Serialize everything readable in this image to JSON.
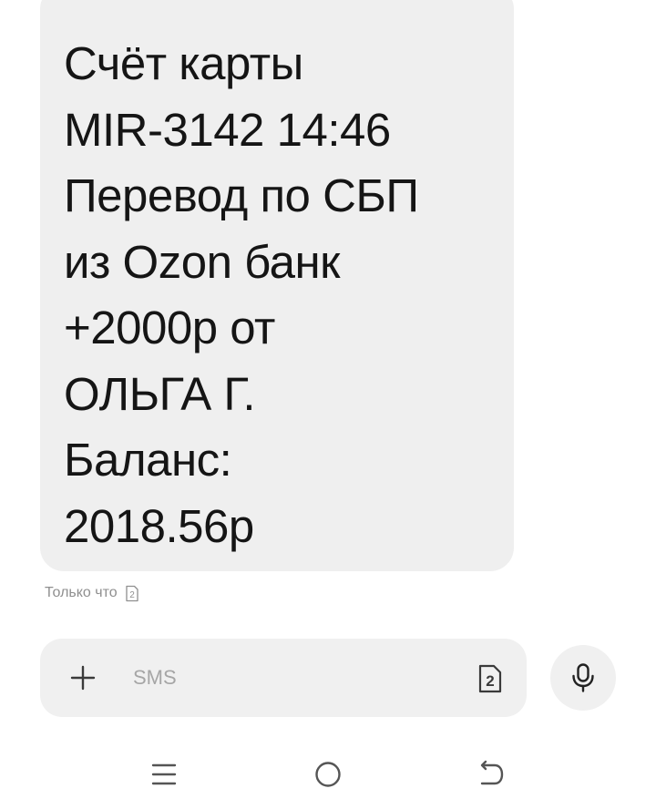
{
  "message": {
    "lines": [
      "Счёт карты",
      "MIR-3142 14:46",
      "Перевод по СБП",
      "из Ozon банк",
      "+2000р от",
      "ОЛЬГА Г.",
      "Баланс:",
      "2018.56р"
    ],
    "time_label": "Только что",
    "sim_number": "2"
  },
  "composer": {
    "placeholder": "SMS",
    "sim_number": "2",
    "icons": {
      "add": "plus-icon",
      "sim": "sim-card-icon",
      "mic": "microphone-icon"
    }
  },
  "navbar": {
    "icons": [
      "menu-icon",
      "home-icon",
      "back-icon"
    ]
  },
  "colors": {
    "bubble": "#efefef",
    "text": "#151515",
    "muted": "#8f8f8f",
    "composer": "#f0f0f0"
  }
}
